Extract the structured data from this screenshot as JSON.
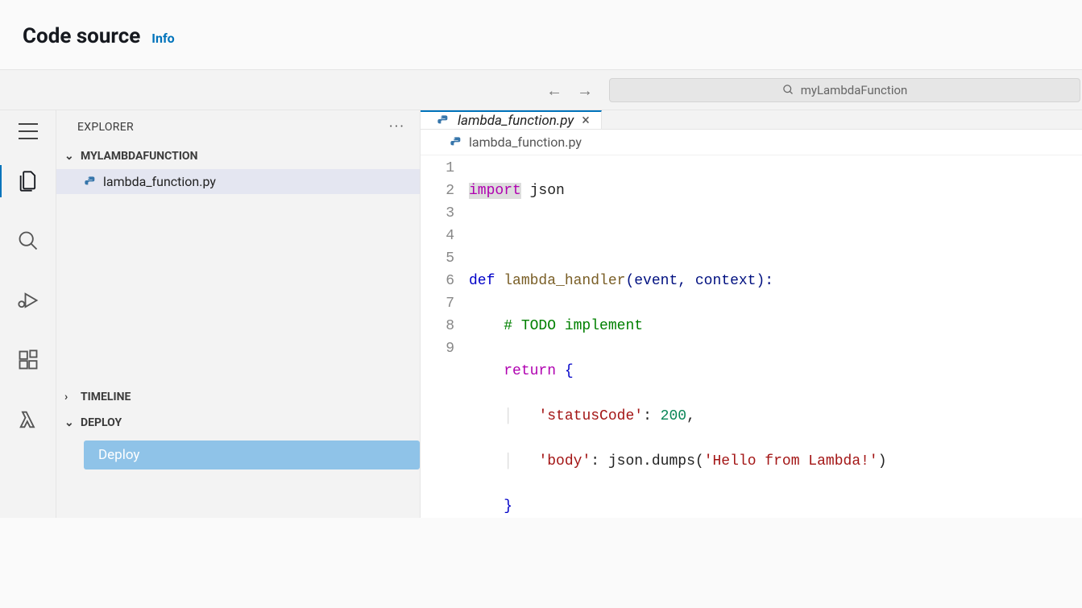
{
  "header": {
    "title": "Code source",
    "info_link": "Info"
  },
  "search": {
    "placeholder": "myLambdaFunction"
  },
  "explorer": {
    "title": "EXPLORER",
    "project_name": "MYLAMBDAFUNCTION",
    "file_name": "lambda_function.py",
    "timeline_label": "TIMELINE",
    "deploy_section_label": "DEPLOY",
    "deploy_button": "Deploy"
  },
  "tab": {
    "label": "lambda_function.py"
  },
  "breadcrumb": {
    "file": "lambda_function.py"
  },
  "code": {
    "line_numbers": [
      "1",
      "2",
      "3",
      "4",
      "5",
      "6",
      "7",
      "8",
      "9"
    ],
    "tokens": {
      "l1_import": "import",
      "l1_json": " json",
      "l3_def": "def ",
      "l3_fn": "lambda_handler",
      "l3_args": "(event, context):",
      "l4_comment": "# TODO implement",
      "l5_return": "return",
      "l5_brace": " {",
      "l6_key": "'statusCode'",
      "l6_colon": ": ",
      "l6_val": "200",
      "l6_comma": ",",
      "l7_key": "'body'",
      "l7_colon": ": json.dumps(",
      "l7_str": "'Hello from Lambda!'",
      "l7_close": ")",
      "l8_brace": "}"
    }
  }
}
